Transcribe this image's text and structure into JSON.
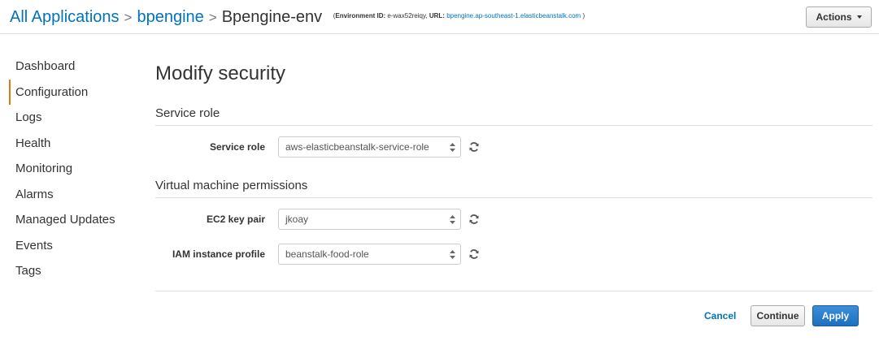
{
  "breadcrumb": {
    "items": [
      "All Applications",
      "bpengine"
    ],
    "separator": ">",
    "current": "Bpengine-env",
    "env_info": {
      "open": "(",
      "id_label": "Environment ID:",
      "id_value": "e-wax52reiqy,",
      "url_label": "URL:",
      "url_value": "bpengine.ap-southeast-1.elasticbeanstalk.com",
      "close": ")"
    }
  },
  "header": {
    "actions_label": "Actions"
  },
  "sidebar": {
    "items": [
      {
        "label": "Dashboard"
      },
      {
        "label": "Configuration"
      },
      {
        "label": "Logs"
      },
      {
        "label": "Health"
      },
      {
        "label": "Monitoring"
      },
      {
        "label": "Alarms"
      },
      {
        "label": "Managed Updates"
      },
      {
        "label": "Events"
      },
      {
        "label": "Tags"
      }
    ],
    "active": "Configuration"
  },
  "main": {
    "title": "Modify security",
    "sections": [
      {
        "title": "Service role",
        "fields": [
          {
            "label": "Service role",
            "value": "aws-elasticbeanstalk-service-role"
          }
        ]
      },
      {
        "title": "Virtual machine permissions",
        "fields": [
          {
            "label": "EC2 key pair",
            "value": "jkoay"
          },
          {
            "label": "IAM instance profile",
            "value": "beanstalk-food-role"
          }
        ]
      }
    ]
  },
  "footer": {
    "cancel_label": "Cancel",
    "continue_label": "Continue",
    "apply_label": "Apply"
  },
  "colors": {
    "link": "#0073bb",
    "active_nav_accent": "#e47911",
    "primary_button": "#1f6fbf",
    "text": "#333333"
  },
  "icons": {
    "refresh": "refresh-icon",
    "select_arrow": "select-arrow-icon",
    "dropdown_caret": "caret-down-icon"
  }
}
